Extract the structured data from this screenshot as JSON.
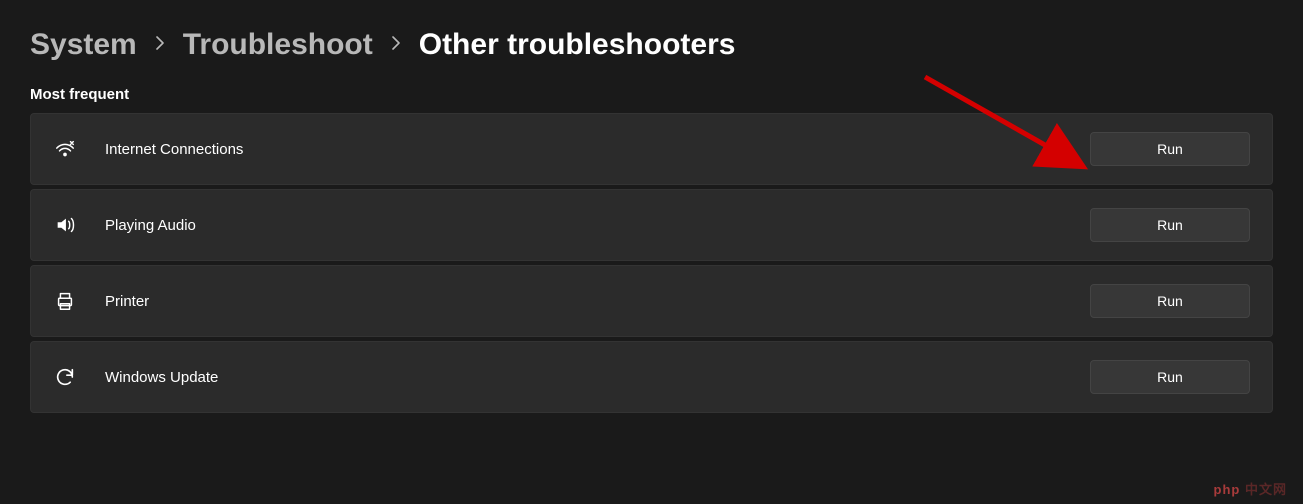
{
  "breadcrumb": {
    "root": "System",
    "parent": "Troubleshoot",
    "current": "Other troubleshooters"
  },
  "section": {
    "title": "Most frequent"
  },
  "items": [
    {
      "icon": "wifi-tool-icon",
      "label": "Internet Connections",
      "action": "Run"
    },
    {
      "icon": "audio-icon",
      "label": "Playing Audio",
      "action": "Run"
    },
    {
      "icon": "printer-icon",
      "label": "Printer",
      "action": "Run"
    },
    {
      "icon": "update-icon",
      "label": "Windows Update",
      "action": "Run"
    }
  ],
  "watermark": "php"
}
